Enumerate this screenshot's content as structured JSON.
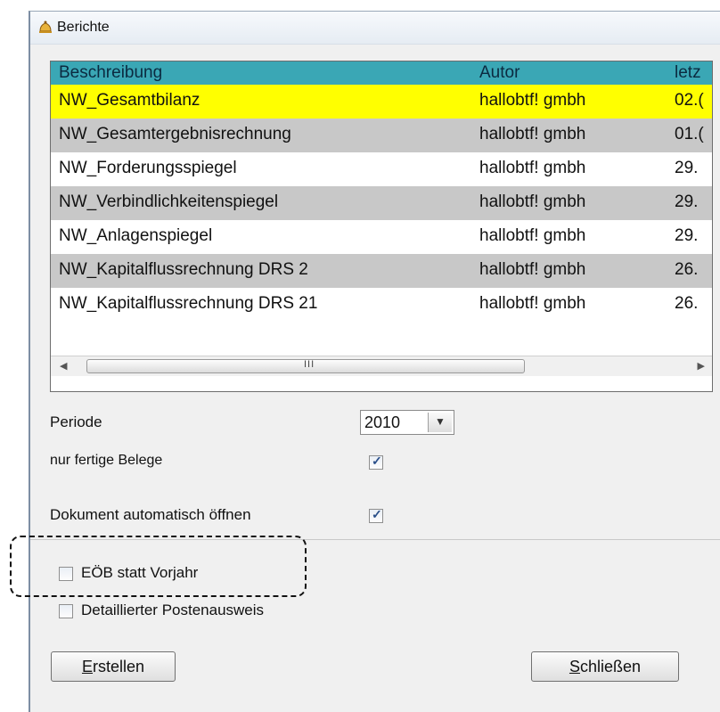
{
  "window": {
    "title": "Berichte"
  },
  "table": {
    "columns": [
      "Beschreibung",
      "Autor",
      "letz"
    ],
    "rows": [
      [
        "NW_Gesamtbilanz",
        "hallobtf! gmbh",
        "02.("
      ],
      [
        "NW_Gesamtergebnisrechnung",
        "hallobtf! gmbh",
        "01.("
      ],
      [
        "NW_Forderungsspiegel",
        "hallobtf! gmbh",
        "29."
      ],
      [
        "NW_Verbindlichkeitenspiegel",
        "hallobtf! gmbh",
        "29."
      ],
      [
        "NW_Anlagenspiegel",
        "hallobtf! gmbh",
        "29."
      ],
      [
        "NW_Kapitalflussrechnung DRS 2",
        "hallobtf! gmbh",
        "26."
      ],
      [
        "NW_Kapitalflussrechnung DRS 21",
        "hallobtf! gmbh",
        "26."
      ]
    ],
    "row_colors": [
      "#ffff00",
      "#c8c8c8",
      "#ffffff",
      "#c8c8c8",
      "#ffffff",
      "#c8c8c8",
      "#ffffff"
    ],
    "scroll_grip": "III"
  },
  "options": {
    "periode_label": "Periode",
    "periode_value": "2010",
    "nur_fertige_label": "nur fertige Belege",
    "nur_fertige_checked": true,
    "dokument_label": "Dokument automatisch öffnen",
    "dokument_checked": true,
    "eob_label": "EÖB statt Vorjahr",
    "eob_checked": false,
    "detail_label": "Detaillierter Postenausweis",
    "detail_checked": false
  },
  "buttons": {
    "erstellen_mnemonic": "E",
    "erstellen_rest": "rstellen",
    "schliessen_mnemonic": "S",
    "schliessen_rest": "chließen"
  },
  "colors": {
    "header": "#3aa7b5",
    "selected_row": "#ffff00",
    "alt_row": "#c8c8c8"
  },
  "icons": {
    "window": "report-bell-icon",
    "dropdown": "chevron-down-icon"
  }
}
